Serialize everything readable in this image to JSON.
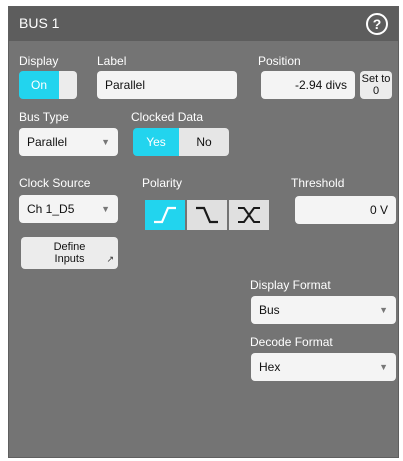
{
  "title": "BUS 1",
  "help_glyph": "?",
  "display": {
    "label": "Display",
    "on": "On"
  },
  "label": {
    "label": "Label",
    "value": "Parallel"
  },
  "position": {
    "label": "Position",
    "value": "-2.94 divs",
    "set_to_zero": "Set to 0"
  },
  "bus_type": {
    "label": "Bus Type",
    "value": "Parallel"
  },
  "clocked_data": {
    "label": "Clocked Data",
    "yes": "Yes",
    "no": "No",
    "selected": "Yes"
  },
  "clock_source": {
    "label": "Clock Source",
    "value": "Ch 1_D5"
  },
  "polarity": {
    "label": "Polarity",
    "options": [
      "rising-edge-icon",
      "falling-edge-icon",
      "either-edge-icon"
    ],
    "selected": 0
  },
  "threshold": {
    "label": "Threshold",
    "value": "0 V"
  },
  "define_inputs": {
    "label": "Define Inputs"
  },
  "display_format": {
    "label": "Display Format",
    "value": "Bus"
  },
  "decode_format": {
    "label": "Decode Format",
    "value": "Hex"
  },
  "colors": {
    "accent": "#22d4ee",
    "panel": "#747474",
    "titlebar": "#5d5d5d"
  }
}
